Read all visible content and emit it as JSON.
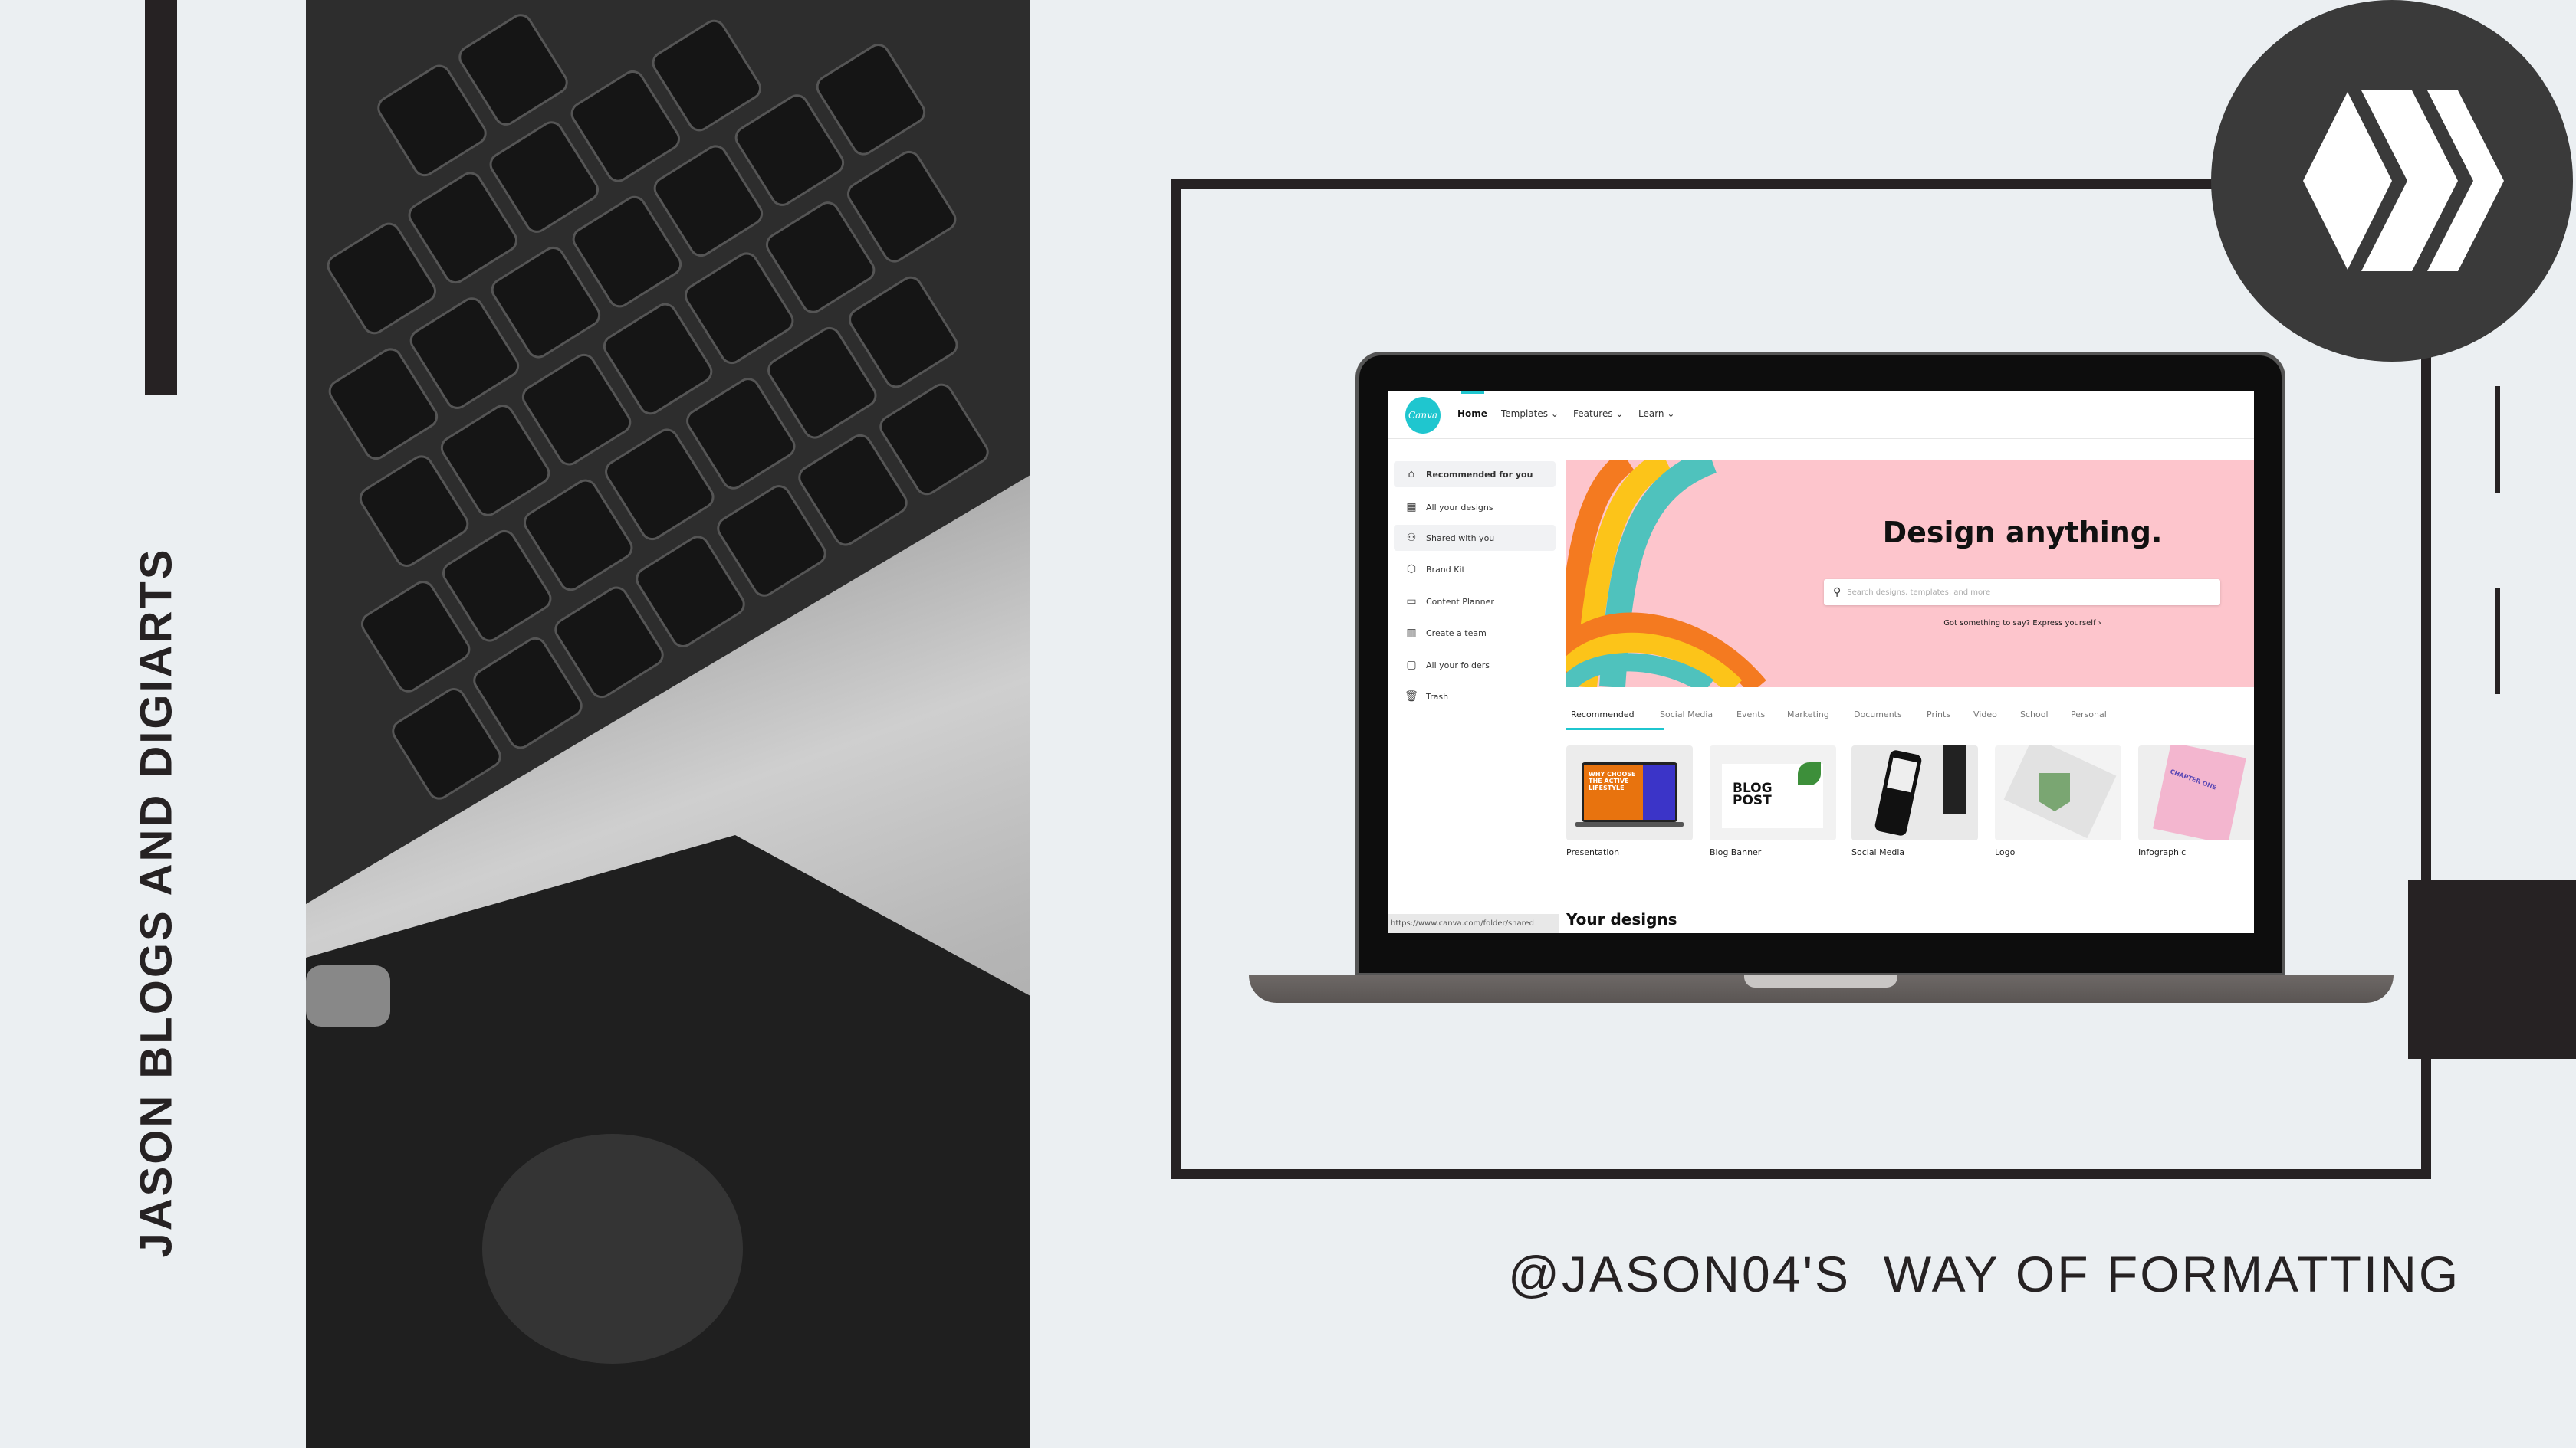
{
  "poster": {
    "vertical_title": "JASON BLOGS AND DIGIARTS",
    "caption": "@JASON04'S  WAY OF FORMATTING",
    "logo": "hive-logo",
    "colors": {
      "background": "#ebeff2",
      "dark": "#262223",
      "canva_teal": "#1fc6cf",
      "banner_pink": "#fdc5cc"
    }
  },
  "canva": {
    "logo_text": "Canva",
    "nav": [
      {
        "label": "Home"
      },
      {
        "label": "Templates ⌄"
      },
      {
        "label": "Features ⌄"
      },
      {
        "label": "Learn ⌄"
      }
    ],
    "sidebar": [
      {
        "label": "Recommended for you",
        "icon": "home-icon"
      },
      {
        "label": "All your designs",
        "icon": "grid-icon"
      },
      {
        "label": "Shared with you",
        "icon": "users-icon"
      },
      {
        "label": "Brand Kit",
        "icon": "brand-kit-icon"
      },
      {
        "label": "Content Planner",
        "icon": "calendar-icon"
      },
      {
        "label": "Create a team",
        "icon": "team-icon"
      },
      {
        "label": "All your folders",
        "icon": "folder-icon"
      },
      {
        "label": "Trash",
        "icon": "trash-icon"
      }
    ],
    "banner": {
      "title": "Design anything.",
      "search_placeholder": "Search designs, templates, and more",
      "subtext": "Got something to say? Express yourself ›"
    },
    "tabs": [
      "Recommended",
      "Social Media",
      "Events",
      "Marketing",
      "Documents",
      "Prints",
      "Video",
      "School",
      "Personal"
    ],
    "active_tab": "Recommended",
    "designs": [
      {
        "label": "Presentation",
        "thumb_text": "WHY CHOOSE THE ACTIVE LIFESTYLE"
      },
      {
        "label": "Blog Banner",
        "thumb_text": "BLOG POST"
      },
      {
        "label": "Social Media"
      },
      {
        "label": "Logo"
      },
      {
        "label": "Infographic",
        "thumb_text": "CHAPTER ONE"
      }
    ],
    "your_designs": "Your designs",
    "status_url": "https://www.canva.com/folder/shared"
  }
}
